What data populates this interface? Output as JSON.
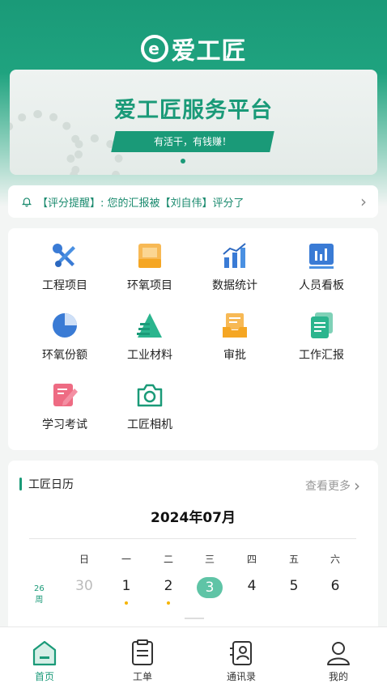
{
  "header": {
    "app_name": "爱工匠",
    "logo_letter": "e"
  },
  "banner": {
    "title": "爱工匠服务平台",
    "slogan": "有活干，有钱赚！"
  },
  "notice": {
    "text": "【评分提醒】: 您的汇报被【刘自伟】评分了"
  },
  "menu": [
    {
      "label": "工程项目",
      "icon": "wrench-screwdriver-icon"
    },
    {
      "label": "环氧项目",
      "icon": "folder-icon"
    },
    {
      "label": "数据统计",
      "icon": "bar-chart-trend-icon"
    },
    {
      "label": "人员看板",
      "icon": "dashboard-chart-icon"
    },
    {
      "label": "环氧份额",
      "icon": "pie-chart-icon"
    },
    {
      "label": "工业材料",
      "icon": "material-pyramid-icon"
    },
    {
      "label": "审批",
      "icon": "approval-inbox-icon"
    },
    {
      "label": "工作汇报",
      "icon": "report-document-icon"
    },
    {
      "label": "学习考试",
      "icon": "study-pen-icon"
    },
    {
      "label": "工匠相机",
      "icon": "camera-icon"
    }
  ],
  "calendar": {
    "title": "工匠日历",
    "more": "查看更多",
    "month": "2024年07月",
    "weekdays": [
      "日",
      "一",
      "二",
      "三",
      "四",
      "五",
      "六"
    ],
    "week_number": "26",
    "week_suffix": "周",
    "days": [
      "30",
      "1",
      "2",
      "3",
      "4",
      "5",
      "6"
    ],
    "today": "3"
  },
  "tabs": [
    {
      "label": "首页",
      "icon": "home-icon",
      "active": true
    },
    {
      "label": "工单",
      "icon": "clipboard-icon",
      "active": false
    },
    {
      "label": "通讯录",
      "icon": "contacts-icon",
      "active": false
    },
    {
      "label": "我的",
      "icon": "user-icon",
      "active": false
    }
  ],
  "colors": {
    "primary": "#1a9a78",
    "today_bg": "#5fc4a6",
    "mark": "#f5b400"
  }
}
